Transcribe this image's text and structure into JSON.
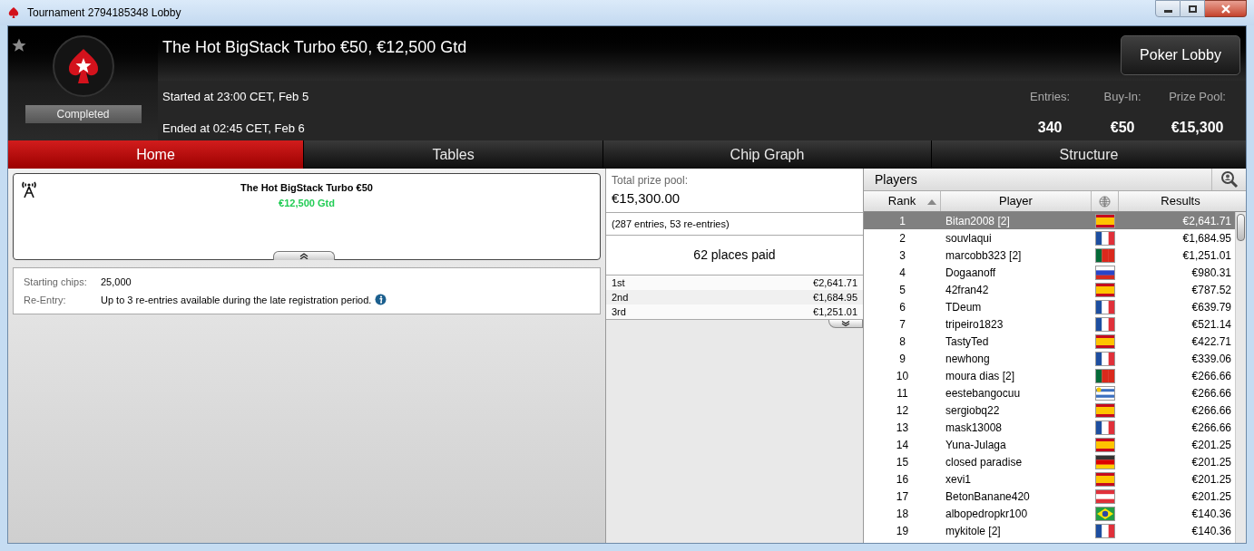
{
  "window": {
    "title": "Tournament 2794185348 Lobby"
  },
  "header": {
    "title": "The Hot BigStack Turbo €50, €12,500 Gtd",
    "status": "Completed",
    "started": "Started at 23:00 CET, Feb 5",
    "ended": "Ended at 02:45 CET, Feb 6",
    "lobby_button": "Poker Lobby",
    "stats": [
      {
        "label": "Entries:",
        "value": "340"
      },
      {
        "label": "Buy-In:",
        "value": "€50"
      },
      {
        "label": "Prize Pool:",
        "value": "€15,300"
      }
    ]
  },
  "tabs": [
    {
      "label": "Home",
      "selected": true
    },
    {
      "label": "Tables",
      "selected": false
    },
    {
      "label": "Chip Graph",
      "selected": false
    },
    {
      "label": "Structure",
      "selected": false
    }
  ],
  "banner": {
    "title": "The Hot BigStack Turbo €50",
    "subtitle": "€12,500 Gtd"
  },
  "details": [
    {
      "label": "Starting chips:",
      "value": "25,000",
      "info": false
    },
    {
      "label": "Re-Entry:",
      "value": "Up to 3 re-entries available during the late registration period.",
      "info": true
    }
  ],
  "prizes": {
    "label": "Total prize pool:",
    "total": "€15,300.00",
    "entries": "(287 entries, 53 re-entries)",
    "paid": "62 places paid",
    "places": [
      {
        "place": "1st",
        "amount": "€2,641.71"
      },
      {
        "place": "2nd",
        "amount": "€1,684.95"
      },
      {
        "place": "3rd",
        "amount": "€1,251.01"
      }
    ]
  },
  "players": {
    "title": "Players",
    "columns": [
      "Rank",
      "Player",
      "Results"
    ],
    "rows": [
      {
        "rank": "1",
        "name": "Bitan2008 [2]",
        "kind": "es",
        "result": "€2,641.71",
        "selected": true
      },
      {
        "rank": "2",
        "name": "souvlaqui",
        "kind": "fr",
        "result": "€1,684.95",
        "selected": false
      },
      {
        "rank": "3",
        "name": "marcobb323 [2]",
        "kind": "pt",
        "result": "€1,251.01",
        "selected": false
      },
      {
        "rank": "4",
        "name": "Dogaanoff",
        "kind": "ru",
        "result": "€980.31",
        "selected": false
      },
      {
        "rank": "5",
        "name": "42fran42",
        "kind": "es",
        "result": "€787.52",
        "selected": false
      },
      {
        "rank": "6",
        "name": "TDeum",
        "kind": "fr",
        "result": "€639.79",
        "selected": false
      },
      {
        "rank": "7",
        "name": "tripeiro1823",
        "kind": "fr",
        "result": "€521.14",
        "selected": false
      },
      {
        "rank": "8",
        "name": "TastyTed",
        "kind": "es",
        "result": "€422.71",
        "selected": false
      },
      {
        "rank": "9",
        "name": "newhong",
        "kind": "fr",
        "result": "€339.06",
        "selected": false
      },
      {
        "rank": "10",
        "name": "moura dias [2]",
        "kind": "pt",
        "result": "€266.66",
        "selected": false
      },
      {
        "rank": "11",
        "name": "eestebangocuu",
        "kind": "uy",
        "result": "€266.66",
        "selected": false
      },
      {
        "rank": "12",
        "name": "sergiobq22",
        "kind": "es",
        "result": "€266.66",
        "selected": false
      },
      {
        "rank": "13",
        "name": "mask13008",
        "kind": "fr",
        "result": "€266.66",
        "selected": false
      },
      {
        "rank": "14",
        "name": "Yuna-Julaga",
        "kind": "es",
        "result": "€201.25",
        "selected": false
      },
      {
        "rank": "15",
        "name": "closed paradise",
        "kind": "de",
        "result": "€201.25",
        "selected": false
      },
      {
        "rank": "16",
        "name": "xevi1",
        "kind": "es",
        "result": "€201.25",
        "selected": false
      },
      {
        "rank": "17",
        "name": "BetonBanane420",
        "kind": "at",
        "result": "€201.25",
        "selected": false
      },
      {
        "rank": "18",
        "name": "albopedropkr100",
        "kind": "br",
        "result": "€140.36",
        "selected": false
      },
      {
        "rank": "19",
        "name": "mykitole [2]",
        "kind": "fr",
        "result": "€140.36",
        "selected": false
      }
    ]
  }
}
